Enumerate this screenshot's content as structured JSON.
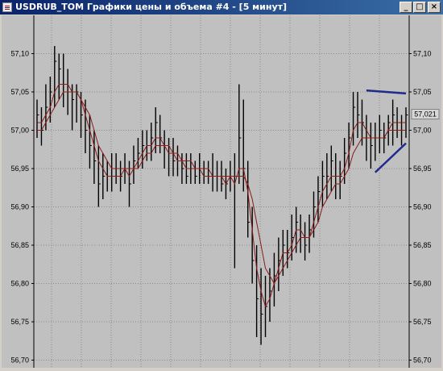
{
  "window": {
    "title": "USDRUB_TOM Графики цены и объема #4 - [5 минут]",
    "controls": {
      "minimize": "_",
      "maximize": "□",
      "close": "×"
    }
  },
  "chart_data": {
    "type": "candlestick",
    "title": "",
    "y_ticks": [
      "57,10",
      "57,05",
      "57,00",
      "56,95",
      "56,90",
      "56,85",
      "56,80",
      "56,75",
      "56,70"
    ],
    "ylim": [
      56.69,
      57.15
    ],
    "grid": true,
    "y_axis_both_sides": true,
    "current_price_label": "57,021",
    "current_price": 57.021,
    "price_bars": [
      {
        "h": 57.04,
        "l": 56.99,
        "c": 57.02
      },
      {
        "h": 57.03,
        "l": 56.98,
        "c": 57.0
      },
      {
        "h": 57.06,
        "l": 57.0,
        "c": 57.03
      },
      {
        "h": 57.07,
        "l": 57.01,
        "c": 57.05
      },
      {
        "h": 57.11,
        "l": 57.03,
        "c": 57.09
      },
      {
        "h": 57.1,
        "l": 57.04,
        "c": 57.08
      },
      {
        "h": 57.1,
        "l": 57.03,
        "c": 57.06
      },
      {
        "h": 57.08,
        "l": 57.02,
        "c": 57.05
      },
      {
        "h": 57.06,
        "l": 57.0,
        "c": 57.04
      },
      {
        "h": 57.06,
        "l": 57.01,
        "c": 57.05
      },
      {
        "h": 57.05,
        "l": 56.99,
        "c": 57.02
      },
      {
        "h": 57.04,
        "l": 56.97,
        "c": 57.0
      },
      {
        "h": 57.02,
        "l": 56.95,
        "c": 56.98
      },
      {
        "h": 57.0,
        "l": 56.93,
        "c": 56.96
      },
      {
        "h": 56.98,
        "l": 56.9,
        "c": 56.93
      },
      {
        "h": 56.97,
        "l": 56.91,
        "c": 56.94
      },
      {
        "h": 56.96,
        "l": 56.92,
        "c": 56.94
      },
      {
        "h": 56.97,
        "l": 56.92,
        "c": 56.95
      },
      {
        "h": 56.97,
        "l": 56.93,
        "c": 56.95
      },
      {
        "h": 56.96,
        "l": 56.92,
        "c": 56.94
      },
      {
        "h": 56.97,
        "l": 56.93,
        "c": 56.95
      },
      {
        "h": 56.96,
        "l": 56.9,
        "c": 56.93
      },
      {
        "h": 56.98,
        "l": 56.93,
        "c": 56.96
      },
      {
        "h": 56.99,
        "l": 56.95,
        "c": 56.97
      },
      {
        "h": 57.0,
        "l": 56.95,
        "c": 56.98
      },
      {
        "h": 57.0,
        "l": 56.96,
        "c": 56.98
      },
      {
        "h": 57.01,
        "l": 56.96,
        "c": 56.99
      },
      {
        "h": 57.03,
        "l": 56.97,
        "c": 57.01
      },
      {
        "h": 57.02,
        "l": 56.97,
        "c": 56.99
      },
      {
        "h": 57.0,
        "l": 56.95,
        "c": 56.98
      },
      {
        "h": 56.99,
        "l": 56.94,
        "c": 56.97
      },
      {
        "h": 56.99,
        "l": 56.94,
        "c": 56.96
      },
      {
        "h": 56.98,
        "l": 56.94,
        "c": 56.96
      },
      {
        "h": 56.97,
        "l": 56.93,
        "c": 56.95
      },
      {
        "h": 56.97,
        "l": 56.93,
        "c": 56.94
      },
      {
        "h": 56.97,
        "l": 56.93,
        "c": 56.95
      },
      {
        "h": 56.96,
        "l": 56.93,
        "c": 56.94
      },
      {
        "h": 56.97,
        "l": 56.93,
        "c": 56.95
      },
      {
        "h": 56.96,
        "l": 56.93,
        "c": 56.94
      },
      {
        "h": 56.96,
        "l": 56.93,
        "c": 56.94
      },
      {
        "h": 56.97,
        "l": 56.92,
        "c": 56.94
      },
      {
        "h": 56.96,
        "l": 56.92,
        "c": 56.94
      },
      {
        "h": 56.96,
        "l": 56.92,
        "c": 56.93
      },
      {
        "h": 56.95,
        "l": 56.91,
        "c": 56.93
      },
      {
        "h": 56.96,
        "l": 56.92,
        "c": 56.94
      },
      {
        "h": 56.97,
        "l": 56.82,
        "c": 56.94
      },
      {
        "h": 57.06,
        "l": 56.93,
        "c": 56.99
      },
      {
        "h": 57.04,
        "l": 56.92,
        "c": 56.95
      },
      {
        "h": 56.96,
        "l": 56.86,
        "c": 56.88
      },
      {
        "h": 56.9,
        "l": 56.8,
        "c": 56.83
      },
      {
        "h": 56.85,
        "l": 56.73,
        "c": 56.78
      },
      {
        "h": 56.82,
        "l": 56.72,
        "c": 56.76
      },
      {
        "h": 56.81,
        "l": 56.73,
        "c": 56.77
      },
      {
        "h": 56.82,
        "l": 56.75,
        "c": 56.79
      },
      {
        "h": 56.84,
        "l": 56.77,
        "c": 56.81
      },
      {
        "h": 56.86,
        "l": 56.79,
        "c": 56.83
      },
      {
        "h": 56.87,
        "l": 56.81,
        "c": 56.85
      },
      {
        "h": 56.87,
        "l": 56.82,
        "c": 56.84
      },
      {
        "h": 56.89,
        "l": 56.83,
        "c": 56.86
      },
      {
        "h": 56.9,
        "l": 56.84,
        "c": 56.88
      },
      {
        "h": 56.89,
        "l": 56.84,
        "c": 56.86
      },
      {
        "h": 56.88,
        "l": 56.83,
        "c": 56.85
      },
      {
        "h": 56.89,
        "l": 56.84,
        "c": 56.87
      },
      {
        "h": 56.92,
        "l": 56.86,
        "c": 56.9
      },
      {
        "h": 56.94,
        "l": 56.88,
        "c": 56.92
      },
      {
        "h": 56.96,
        "l": 56.9,
        "c": 56.94
      },
      {
        "h": 56.97,
        "l": 56.91,
        "c": 56.94
      },
      {
        "h": 56.98,
        "l": 56.92,
        "c": 56.96
      },
      {
        "h": 56.97,
        "l": 56.91,
        "c": 56.94
      },
      {
        "h": 56.96,
        "l": 56.91,
        "c": 56.94
      },
      {
        "h": 56.99,
        "l": 56.93,
        "c": 56.97
      },
      {
        "h": 57.01,
        "l": 56.95,
        "c": 56.99
      },
      {
        "h": 57.05,
        "l": 56.98,
        "c": 57.03
      },
      {
        "h": 57.05,
        "l": 56.99,
        "c": 57.02
      },
      {
        "h": 57.04,
        "l": 56.98,
        "c": 57.01
      },
      {
        "h": 57.02,
        "l": 56.96,
        "c": 56.99
      },
      {
        "h": 57.01,
        "l": 56.95,
        "c": 56.98
      },
      {
        "h": 57.01,
        "l": 56.96,
        "c": 56.99
      },
      {
        "h": 57.02,
        "l": 56.97,
        "c": 57.0
      },
      {
        "h": 57.01,
        "l": 56.97,
        "c": 56.99
      },
      {
        "h": 57.02,
        "l": 56.98,
        "c": 57.01
      },
      {
        "h": 57.04,
        "l": 56.98,
        "c": 57.02
      },
      {
        "h": 57.03,
        "l": 56.99,
        "c": 57.01
      },
      {
        "h": 57.02,
        "l": 56.98,
        "c": 57.0
      },
      {
        "h": 57.03,
        "l": 56.99,
        "c": 57.02
      }
    ],
    "moving_averages": [
      {
        "values": [
          57.01,
          57.01,
          57.02,
          57.03,
          57.05,
          57.06,
          57.06,
          57.06,
          57.05,
          57.05,
          57.04,
          57.02,
          57.0,
          56.98,
          56.96,
          56.95,
          56.94,
          56.94,
          56.94,
          56.94,
          56.95,
          56.94,
          56.95,
          56.96,
          56.97,
          56.98,
          56.98,
          56.99,
          56.99,
          56.98,
          56.97,
          56.97,
          56.96,
          56.96,
          56.95,
          56.95,
          56.95,
          56.95,
          56.94,
          56.94,
          56.94,
          56.94,
          56.94,
          56.93,
          56.94,
          56.93,
          56.95,
          56.95,
          56.92,
          56.87,
          56.82,
          56.79,
          56.77,
          56.78,
          56.8,
          56.82,
          56.84,
          56.84,
          56.85,
          56.87,
          56.87,
          56.86,
          56.86,
          56.88,
          56.9,
          56.92,
          56.93,
          56.94,
          56.94,
          56.94,
          56.95,
          56.97,
          57.0,
          57.01,
          57.01,
          57.0,
          56.99,
          56.99,
          56.99,
          56.99,
          57.0,
          57.01,
          57.01,
          57.01,
          57.01
        ]
      },
      {
        "values": [
          57.0,
          57.0,
          57.01,
          57.02,
          57.03,
          57.04,
          57.05,
          57.05,
          57.05,
          57.05,
          57.04,
          57.03,
          57.02,
          57.0,
          56.98,
          56.97,
          56.96,
          56.95,
          56.95,
          56.95,
          56.95,
          56.95,
          56.95,
          56.95,
          56.96,
          56.97,
          56.97,
          56.98,
          56.98,
          56.98,
          56.98,
          56.97,
          56.97,
          56.96,
          56.96,
          56.96,
          56.95,
          56.95,
          56.95,
          56.95,
          56.94,
          56.94,
          56.94,
          56.94,
          56.94,
          56.94,
          56.94,
          56.94,
          56.93,
          56.91,
          56.88,
          56.85,
          56.82,
          56.81,
          56.8,
          56.81,
          56.82,
          56.83,
          56.84,
          56.85,
          56.86,
          56.86,
          56.86,
          56.87,
          56.88,
          56.9,
          56.91,
          56.92,
          56.93,
          56.93,
          56.94,
          56.95,
          56.97,
          56.98,
          56.99,
          56.99,
          56.99,
          56.99,
          56.99,
          56.99,
          57.0,
          57.0,
          57.0,
          57.0,
          57.0
        ]
      }
    ],
    "trendlines": [
      {
        "from": {
          "bar": 75,
          "price": 57.052
        },
        "to": {
          "bar": 84,
          "price": 57.048
        }
      },
      {
        "from": {
          "bar": 77,
          "price": 56.945
        },
        "to": {
          "bar": 84,
          "price": 56.983
        }
      }
    ],
    "colors": {
      "background": "#c0c0c0",
      "grid": "#8c8c8c",
      "candles": "#000000",
      "ma": "#8b1a1a",
      "trendline": "#1e2a8c"
    }
  }
}
